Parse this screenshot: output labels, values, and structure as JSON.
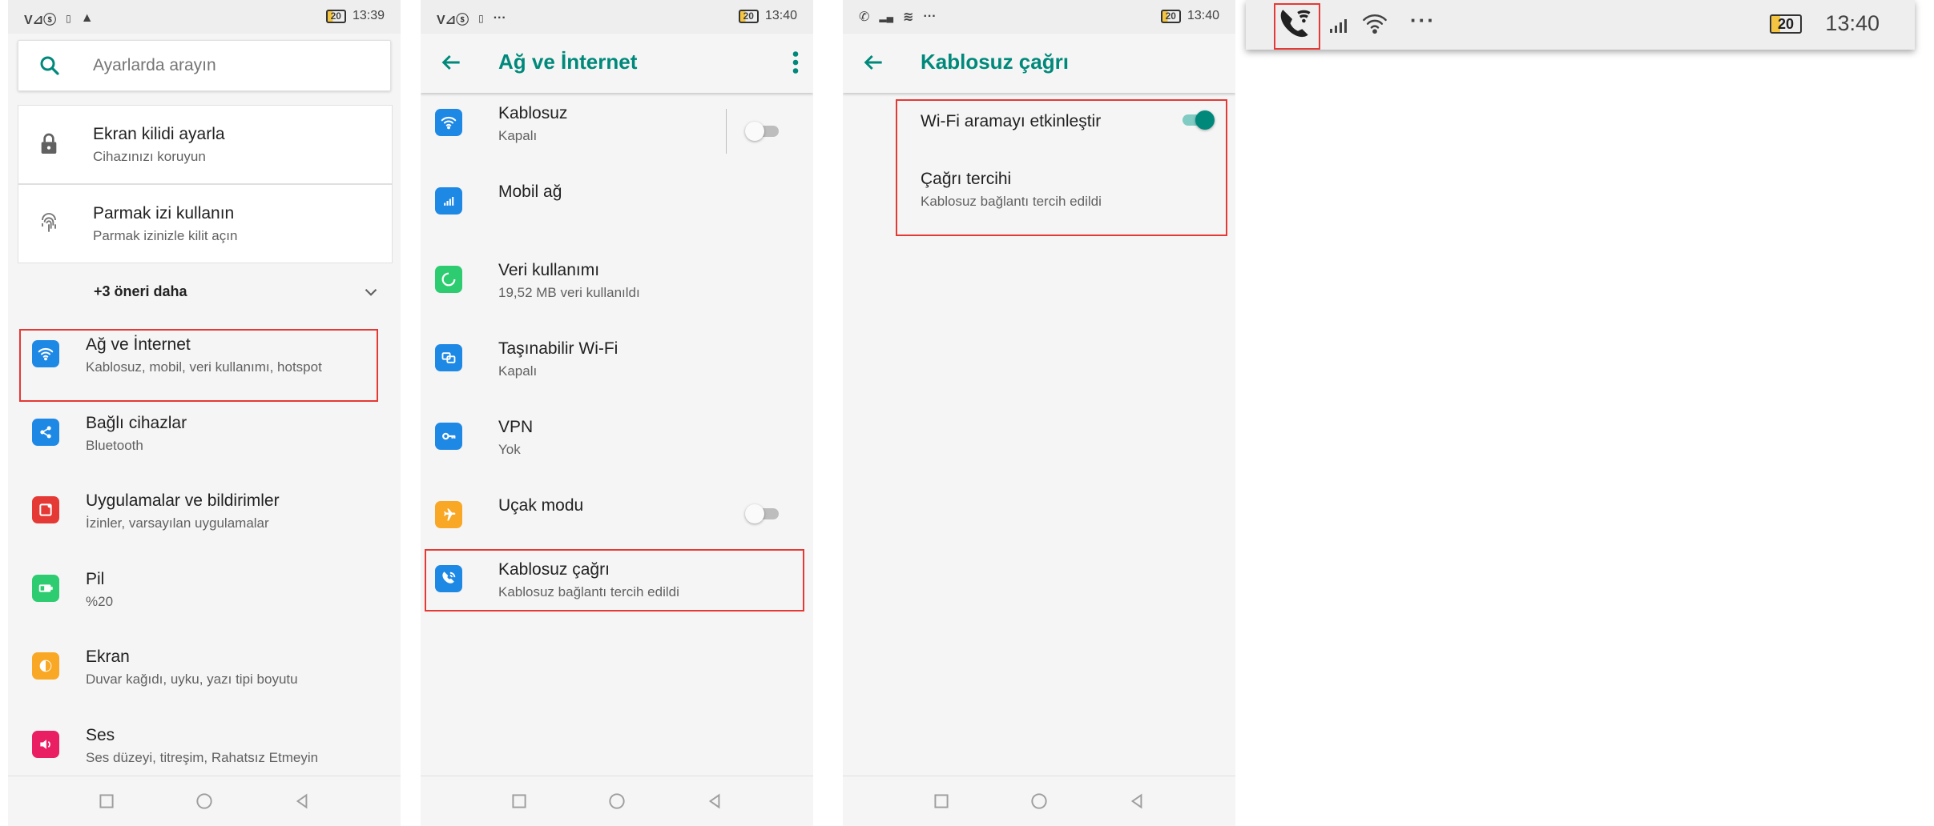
{
  "colors": {
    "accent": "#00897b",
    "highlight": "#e53935",
    "icon_network": "#1e88e5",
    "icon_green": "#2ecc71",
    "icon_red": "#e53935",
    "icon_orange": "#f9a825",
    "icon_pink": "#e91e63"
  },
  "screen1": {
    "status": {
      "carrier": "V⊿ⓢ",
      "time": "13:39",
      "battery": "20"
    },
    "search": {
      "placeholder": "Ayarlarda arayın"
    },
    "suggestions": [
      {
        "title": "Ekran kilidi ayarla",
        "subtitle": "Cihazınızı koruyun",
        "icon": "lock-icon"
      },
      {
        "title": "Parmak izi kullanın",
        "subtitle": "Parmak izinizle kilit açın",
        "icon": "fingerprint-icon"
      }
    ],
    "more_suggestions": "+3 öneri daha",
    "items": [
      {
        "title": "Ağ ve İnternet",
        "subtitle": "Kablosuz, mobil, veri kullanımı, hotspot",
        "icon": "wifi-icon"
      },
      {
        "title": "Bağlı cihazlar",
        "subtitle": "Bluetooth",
        "icon": "share-icon"
      },
      {
        "title": "Uygulamalar ve bildirimler",
        "subtitle": "İzinler, varsayılan uygulamalar",
        "icon": "apps-icon"
      },
      {
        "title": "Pil",
        "subtitle": "%20",
        "icon": "battery-icon"
      },
      {
        "title": "Ekran",
        "subtitle": "Duvar kağıdı, uyku, yazı tipi boyutu",
        "icon": "brightness-icon"
      },
      {
        "title": "Ses",
        "subtitle": "Ses düzeyi, titreşim, Rahatsız Etmeyin",
        "icon": "volume-icon"
      }
    ]
  },
  "screen2": {
    "status": {
      "carrier": "V⊿ⓢ",
      "time": "13:40",
      "battery": "20"
    },
    "title": "Ağ ve İnternet",
    "items": [
      {
        "title": "Kablosuz",
        "subtitle": "Kapalı",
        "icon": "wifi-icon"
      },
      {
        "title": "Mobil ağ",
        "subtitle": "",
        "icon": "signal-icon"
      },
      {
        "title": "Veri kullanımı",
        "subtitle": "19,52 MB veri kullanıldı",
        "icon": "data-usage-icon"
      },
      {
        "title": "Taşınabilir Wi-Fi",
        "subtitle": "Kapalı",
        "icon": "hotspot-icon"
      },
      {
        "title": "VPN",
        "subtitle": "Yok",
        "icon": "vpn-key-icon"
      },
      {
        "title": "Uçak modu",
        "subtitle": "",
        "icon": "airplane-icon"
      },
      {
        "title": "Kablosuz çağrı",
        "subtitle": "Kablosuz bağlantı tercih edildi",
        "icon": "wifi-call-icon"
      }
    ],
    "wifi_toggle_on": false,
    "airplane_toggle_on": false
  },
  "screen3": {
    "status": {
      "time": "13:40",
      "battery": "20"
    },
    "title": "Kablosuz çağrı",
    "enable_label": "Wi-Fi aramayı etkinleştir",
    "enable_on": true,
    "preference_title": "Çağrı tercihi",
    "preference_subtitle": "Kablosuz bağlantı tercih edildi"
  },
  "zoom": {
    "time": "13:40",
    "battery": "20"
  }
}
